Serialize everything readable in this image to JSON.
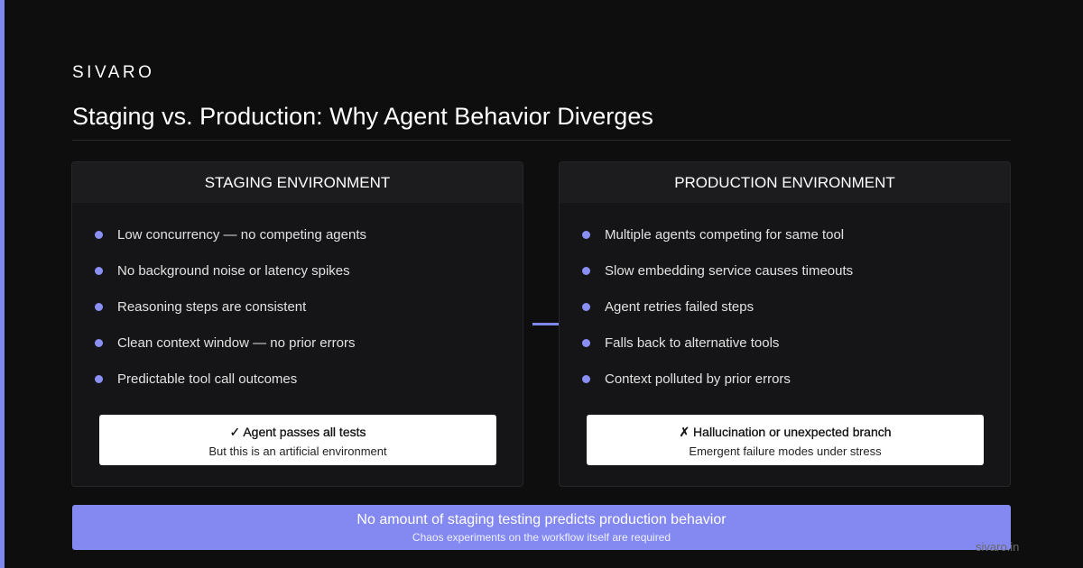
{
  "brand": "SIVARO",
  "title": "Staging vs. Production: Why Agent Behavior Diverges",
  "staging": {
    "header": "STAGING ENVIRONMENT",
    "items": [
      "Low concurrency — no competing agents",
      "No background noise or latency spikes",
      "Reasoning steps are consistent",
      "Clean context window — no prior errors",
      "Predictable tool call outcomes"
    ],
    "result_title": "✓ Agent passes all tests",
    "result_subtitle": "But this is an artificial environment"
  },
  "production": {
    "header": "PRODUCTION ENVIRONMENT",
    "items": [
      "Multiple agents competing for same tool",
      "Slow embedding service causes timeouts",
      "Agent retries failed steps",
      "Falls back to alternative tools",
      "Context polluted by prior errors"
    ],
    "result_title": "✗ Hallucination or unexpected branch",
    "result_subtitle": "Emergent failure modes under stress"
  },
  "banner": {
    "title": "No amount of staging testing predicts production behavior",
    "subtitle": "Chaos experiments on the workflow itself are required"
  },
  "footer_url": "sivaro.in",
  "colors": {
    "accent": "#7f87f0",
    "background": "#0e0e0e",
    "panel": "#151517",
    "bullet": "#8a90f3"
  }
}
